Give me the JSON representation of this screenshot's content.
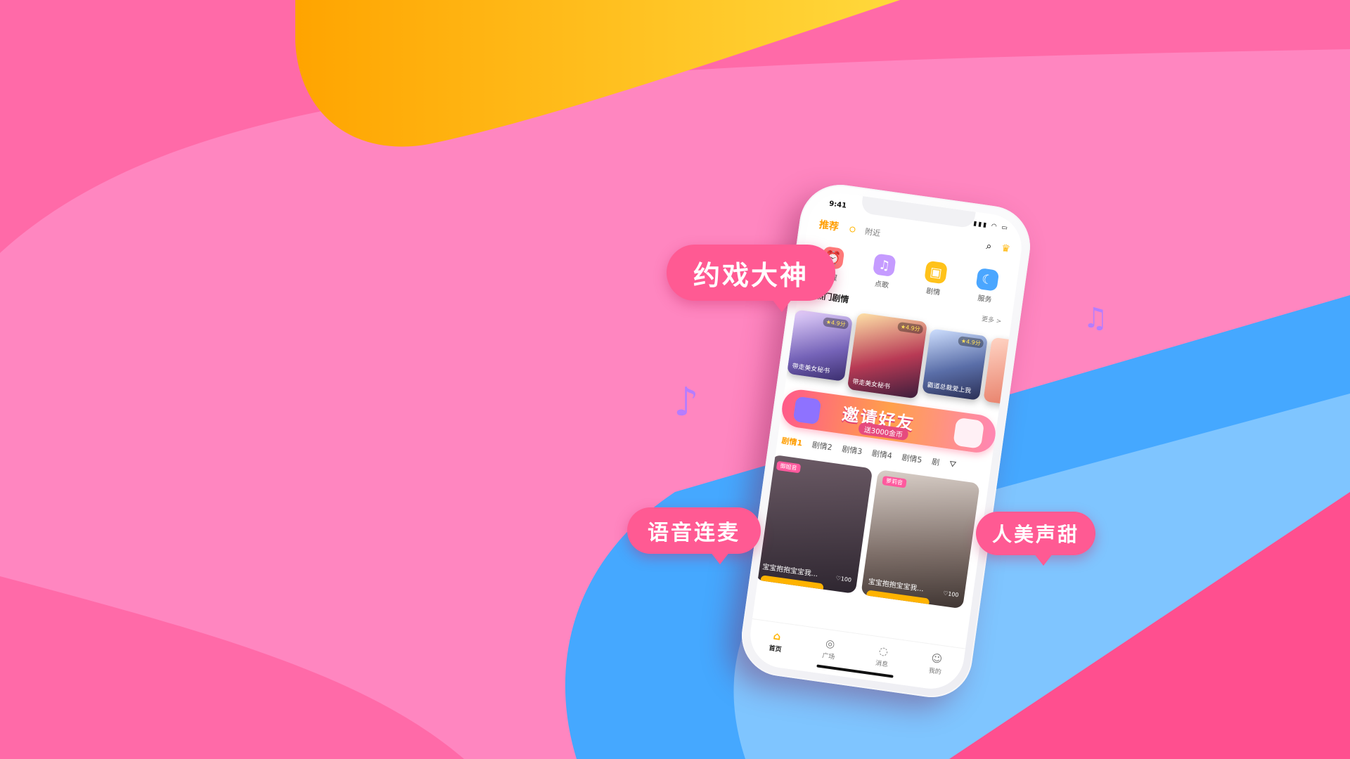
{
  "colors": {
    "background": "#ff86c0",
    "accent_pink": "#ff5a93",
    "brand_orange": "#ff9d00",
    "stripe_blue": "#45a8ff"
  },
  "bubbles": {
    "top": "约戏大神",
    "left": "语音连麦",
    "right": "人美声甜"
  },
  "phone": {
    "status": {
      "time": "9:41",
      "icons": "signal-icon wifi-icon battery-icon"
    },
    "top_tabs": [
      {
        "label": "推荐"
      },
      {
        "label": "附近"
      }
    ],
    "categories": [
      {
        "label": "叫醒",
        "icon": "alarm-clock-icon"
      },
      {
        "label": "点歌",
        "icon": "music-note-icon"
      },
      {
        "label": "剧情",
        "icon": "script-book-icon"
      },
      {
        "label": "服务",
        "icon": "moon-star-icon"
      }
    ],
    "hot": {
      "title": "热门剧情",
      "more": "更多 >"
    },
    "posters": [
      {
        "caption": "带走美女秘书",
        "rating": "★4.9分"
      },
      {
        "caption": "带走美女秘书",
        "rating": "★4.9分"
      },
      {
        "caption": "霸道总裁爱上我",
        "rating": "★4.9分"
      }
    ],
    "invite": {
      "title": "邀请好友",
      "subtitle": "送3000金币"
    },
    "sub_tabs": [
      "剧情1",
      "剧情2",
      "剧情3",
      "剧情4",
      "剧情5",
      "剧"
    ],
    "cards": [
      {
        "badge": "御姐音",
        "caption": "宝宝抱抱宝宝我...",
        "count": "♡100"
      },
      {
        "badge": "萝莉音",
        "caption": "宝宝抱抱宝宝我...",
        "count": "♡100"
      }
    ],
    "nav": [
      {
        "label": "首页",
        "icon": "home-icon"
      },
      {
        "label": "广场",
        "icon": "square-icon"
      },
      {
        "label": "消息",
        "icon": "message-icon"
      },
      {
        "label": "我的",
        "icon": "profile-icon"
      }
    ]
  }
}
